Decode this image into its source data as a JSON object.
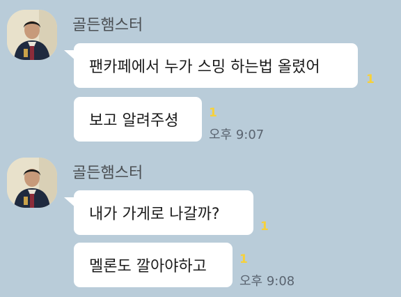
{
  "colors": {
    "background": "#b9ccd9",
    "bubble": "#ffffff",
    "unread": "#f7d13a",
    "sender_text": "#4b4f53",
    "time_text": "#5a6470"
  },
  "groups": [
    {
      "sender": "골든햄스터",
      "avatar_icon": "profile-photo",
      "messages": [
        {
          "text": "팬카페에서 누가 스밍 하는법 올렸어",
          "unread": "1"
        },
        {
          "text": "보고 알려주셩",
          "unread": "1",
          "time": "오후 9:07"
        }
      ]
    },
    {
      "sender": "골든햄스터",
      "avatar_icon": "profile-photo",
      "messages": [
        {
          "text": "내가 가게로  나갈까?",
          "unread": "1"
        },
        {
          "text": "멜론도 깔아야하고",
          "unread": "1",
          "time": "오후 9:08"
        }
      ]
    }
  ]
}
